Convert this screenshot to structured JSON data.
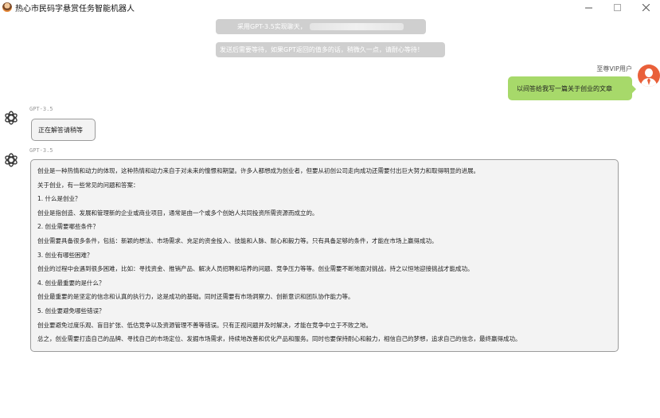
{
  "window": {
    "title": "热心市民码字悬赏任务智能机器人",
    "controls": {
      "minimize": "—",
      "maximize": "☐",
      "close": "✕"
    }
  },
  "notices": {
    "model_notice": "采用GPT-3.5实现聊天，",
    "wait_notice": "发送后需要等待，如果GPT返回的值多的话，稍微久一点，请耐心等待！"
  },
  "user": {
    "name": "至尊VIP用户",
    "message": "以间答给我写一篇关于创业的文章"
  },
  "bot": {
    "name_1": "GPT-3.5",
    "pending": "正在解答请稍等",
    "name_2": "GPT-3.5",
    "answer_lines": [
      "创业是一种热情和动力的体现，这种热情和动力来自于对未来的憧憬和期望。许多人都想成为创业者，但要从初创公司走向成功还需要付出巨大努力和取得明显的进展。",
      "关于创业，有一些常见的问题和答案：",
      "1. 什么是创业？",
      "创业是指创造、发展和管理新的企业或商业项目，通常是由一个或多个创始人共同投资所需资源而成立的。",
      "2. 创业需要哪些条件？",
      "创业需要具备很多条件，包括：新颖的想法、市场需求、充足的资金投入、技能和人脉、耐心和毅力等。只有具备足够的条件，才能在市场上赢得成功。",
      "3. 创业有哪些困难？",
      "创业的过程中会遇到很多困难，比如：寻找资金、推销产品、解决人员招聘和培养的问题、竞争压力等等。创业需要不断地面对挑战，持之以恒地迎接挑战才能成功。",
      "4. 创业最重要的是什么？",
      "创业最重要的是坚定的信念和认真的执行力，这是成功的基础。同时还需要有市场洞察力、创新意识和团队协作能力等。",
      "5. 创业要避免哪些错误？",
      "创业要避免过度乐观、盲目扩张、低估竞争以及资源管理不善等错误。只有正视问题并及时解决，才能在竞争中立于不败之地。",
      "总之，创业需要打造自己的品牌、寻找自己的市场定位、发掘市场需求，持续地改善和优化产品和服务。同时也要保持耐心和毅力，相信自己的梦想，追求自己的信念，最终赢得成功。"
    ]
  },
  "colors": {
    "user_bubble": "#a7d96a",
    "bot_bubble": "#f3f3f3",
    "notice_bg": "#cfcfcf",
    "user_avatar": "#e9603a"
  },
  "icons": {
    "app": "robot-avatar-icon",
    "user_avatar": "vip-user-icon",
    "bot_avatar": "openai-logo-icon"
  }
}
